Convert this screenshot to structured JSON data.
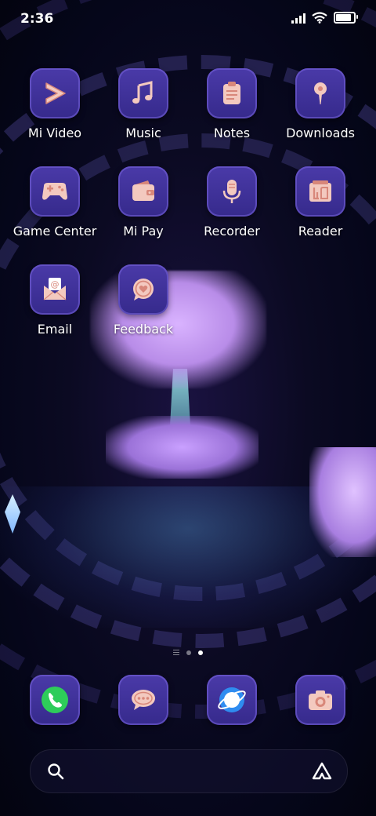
{
  "status_bar": {
    "time": "2:36",
    "battery_level": 0.78
  },
  "apps": [
    {
      "name": "mi-video",
      "label": "Mi Video",
      "icon": "play-icon"
    },
    {
      "name": "music",
      "label": "Music",
      "icon": "music-note-icon"
    },
    {
      "name": "notes",
      "label": "Notes",
      "icon": "clipboard-icon"
    },
    {
      "name": "downloads",
      "label": "Downloads",
      "icon": "download-pin-icon"
    },
    {
      "name": "game-center",
      "label": "Game Center",
      "icon": "gamepad-icon"
    },
    {
      "name": "mi-pay",
      "label": "Mi Pay",
      "icon": "wallet-icon"
    },
    {
      "name": "recorder",
      "label": "Recorder",
      "icon": "microphone-icon"
    },
    {
      "name": "reader",
      "label": "Reader",
      "icon": "book-icon"
    },
    {
      "name": "email",
      "label": "Email",
      "icon": "envelope-icon"
    },
    {
      "name": "feedback",
      "label": "Feedback",
      "icon": "heart-chat-icon"
    }
  ],
  "dock": [
    {
      "name": "phone",
      "icon": "phone-icon"
    },
    {
      "name": "messages",
      "icon": "chat-bubble-icon"
    },
    {
      "name": "browser",
      "icon": "browser-globe-icon"
    },
    {
      "name": "camera",
      "icon": "camera-icon"
    }
  ],
  "page_indicator": {
    "pages": 2,
    "active": 2
  },
  "colors": {
    "icon_bg": "#3d2f98",
    "glyph": "#f3c9bf",
    "glyph_dark": "#d8877a",
    "phone_green": "#2ecc5a",
    "browser_blue": "#2f8cf0"
  },
  "search_bar": {
    "left_icon": "search-icon",
    "right_icon": "assistant-icon"
  }
}
